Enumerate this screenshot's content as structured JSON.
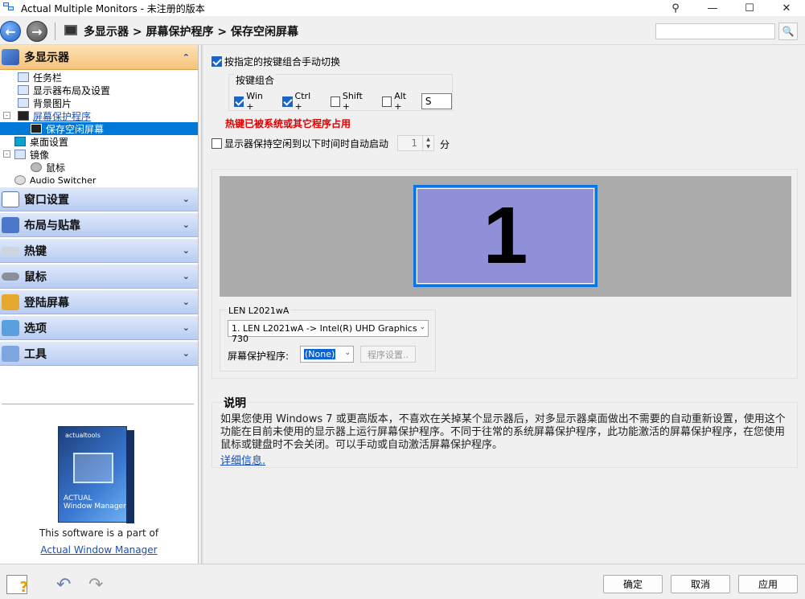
{
  "window": {
    "title": "Actual Multiple Monitors - 未注册的版本",
    "pin_glyph": "⚲",
    "min_glyph": "—",
    "max_glyph": "☐",
    "close_glyph": "✕"
  },
  "nav": {
    "back_glyph": "←",
    "forward_glyph": "→",
    "breadcrumb": "多显示器 > 屏幕保护程序 > 保存空闲屏幕",
    "search_placeholder": "",
    "search_icon_glyph": "🔍"
  },
  "sidebar": {
    "open_category": "多显示器",
    "tree": [
      {
        "label": "任务栏",
        "indent": 1
      },
      {
        "label": "显示器布局及设置",
        "indent": 1
      },
      {
        "label": "背景图片",
        "indent": 1
      },
      {
        "label": "屏幕保护程序",
        "indent": 1,
        "expander": "-"
      },
      {
        "label": "保存空闲屏幕",
        "indent": 2,
        "selected": true
      },
      {
        "label": "桌面设置",
        "indent": 1
      },
      {
        "label": "镜像",
        "indent": 1,
        "expander": "-"
      },
      {
        "label": "鼠标",
        "indent": 2
      },
      {
        "label": "Audio Switcher",
        "indent": 1
      }
    ],
    "categories": [
      "窗口设置",
      "布局与贴靠",
      "热键",
      "鼠标",
      "登陆屏幕",
      "选项",
      "工具"
    ],
    "chevron_up": "⌃",
    "chevron_down": "⌄",
    "product_box": {
      "brand": "actualtools",
      "product_line1": "ACTUAL",
      "product_line2": "Window Manager"
    },
    "part_of_text": "This software is a part of",
    "product_link": "Actual Window Manager"
  },
  "main": {
    "manual_switch_label": "按指定的按键组合手动切换",
    "manual_switch_checked": true,
    "hotkey_group_label": "按键组合",
    "hotkeys": [
      {
        "label": "Win +",
        "checked": true
      },
      {
        "label": "Ctrl +",
        "checked": true
      },
      {
        "label": "Shift +",
        "checked": false
      },
      {
        "label": "Alt +",
        "checked": false
      }
    ],
    "hotkey_key": "S",
    "hotkey_warning": "热键已被系统或其它程序占用",
    "auto_start_label": "显示器保持空闲到以下时间时自动启动",
    "auto_start_checked": false,
    "auto_start_minutes": "1",
    "minutes_unit": "分",
    "monitor_number": "1",
    "device_group_label": "LEN L2021wA",
    "device_selected": "1. LEN L2021wA -> Intel(R) UHD Graphics 730",
    "screensaver_label": "屏幕保护程序:",
    "screensaver_selected": "(None)",
    "screensaver_settings_button": "程序设置..",
    "description_title": "说明",
    "description_text": "如果您使用 Windows 7 或更高版本，不喜欢在关掉某个显示器后，对多显示器桌面做出不需要的自动重新设置，使用这个功能在目前未使用的显示器上运行屏幕保护程序。不同于往常的系统屏幕保护程序，此功能激活的屏幕保护程序，在您使用鼠标或键盘时不会关闭。可以手动或自动激活屏幕保护程序。",
    "more_info_link": "详细信息.",
    "caret_glyph": "⌄",
    "spin_up": "▲",
    "spin_down": "▼"
  },
  "footer": {
    "ok_label": "确定",
    "cancel_label": "取消",
    "apply_label": "应用",
    "help_glyph": "?",
    "undo_glyph": "↶",
    "redo_glyph": "↷"
  },
  "colors": {
    "accent": "#0078d7",
    "warning": "#e00000",
    "monitor_fill": "#9090d8",
    "monitor_border": "#0a74e0",
    "open_category": "#f6c27a",
    "closed_category": "#b9cdf2"
  }
}
